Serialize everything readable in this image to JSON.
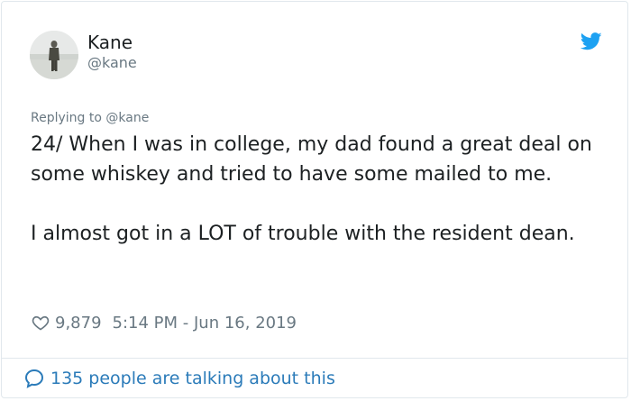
{
  "author": {
    "name": "Kane",
    "handle": "@kane"
  },
  "tweet": {
    "replying_to": "Replying to @kane",
    "paragraphs": [
      "24/ When I was in college, my dad found a great deal on some whiskey and tried to have some mailed to me.",
      "I almost got in a LOT of trouble with the resident dean."
    ],
    "likes": "9,879",
    "timestamp": "5:14 PM - Jun 16, 2019"
  },
  "footer": {
    "talking_label": "135 people are talking about this"
  },
  "icons": {
    "brand": "twitter-bird-icon",
    "like": "heart-icon",
    "conversation": "speech-bubble-icon"
  },
  "colors": {
    "twitter_blue": "#1da1f2",
    "link_blue": "#2b7bb9",
    "muted_gray": "#697882",
    "text_dark": "#1c2022"
  }
}
